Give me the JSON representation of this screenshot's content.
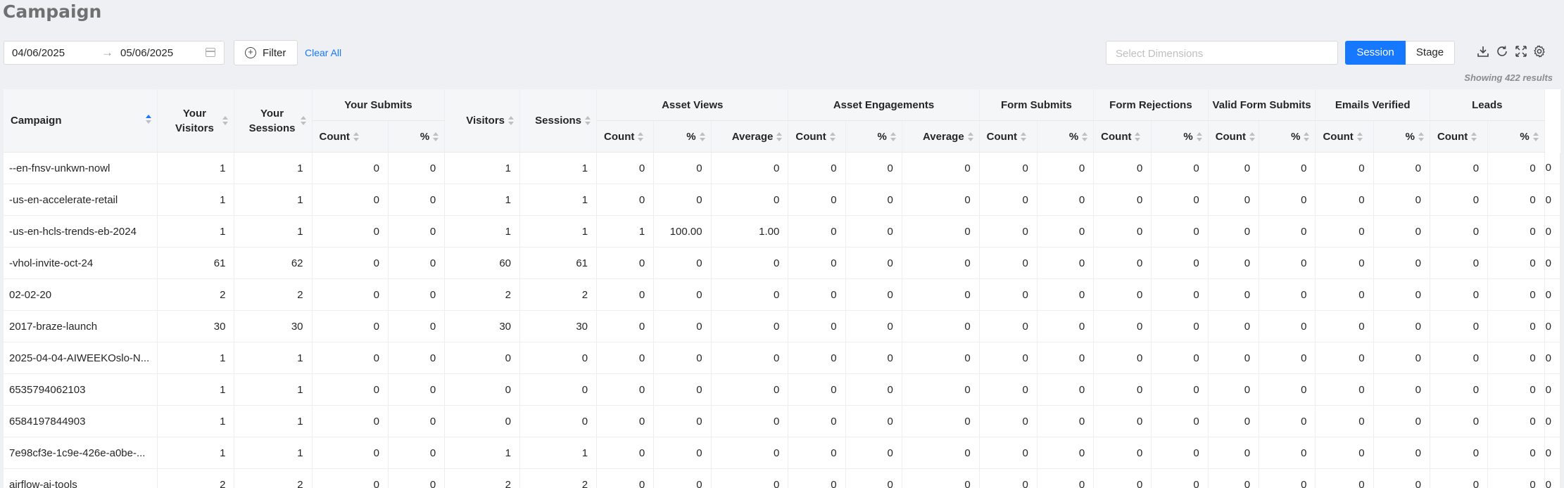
{
  "page": {
    "title": "Campaign"
  },
  "toolbar": {
    "date_start": "04/06/2025",
    "date_end": "05/06/2025",
    "filter_label": "Filter",
    "clear_all_label": "Clear All",
    "dimensions_placeholder": "Select Dimensions",
    "session_label": "Session",
    "stage_label": "Stage",
    "accent_color": "#1677ff",
    "icons": [
      "download-icon",
      "refresh-icon",
      "fullscreen-icon",
      "settings-icon"
    ]
  },
  "results_text": "Showing 422 results",
  "table": {
    "groups": {
      "campaign": "Campaign",
      "your_visitors": "Your Visitors",
      "your_sessions": "Your Sessions",
      "your_submits": "Your Submits",
      "visitors": "Visitors",
      "sessions": "Sessions",
      "asset_views": "Asset Views",
      "asset_engagements": "Asset Engagements",
      "form_submits": "Form Submits",
      "form_rejections": "Form Rejections",
      "valid_form_submits": "Valid Form Submits",
      "emails_verified": "Emails Verified",
      "leads": "Leads"
    },
    "sub": {
      "count": "Count",
      "pct": "%",
      "average": "Average"
    },
    "rows": [
      {
        "name": "--en-fnsv-unkwn-nowl",
        "cells": [
          "1",
          "1",
          "0",
          "0",
          "1",
          "1",
          "0",
          "0",
          "0",
          "0",
          "0",
          "0",
          "0",
          "0",
          "0",
          "0",
          "0",
          "0",
          "0",
          "0",
          "0",
          "0",
          "0"
        ]
      },
      {
        "name": "-us-en-accelerate-retail",
        "cells": [
          "1",
          "1",
          "0",
          "0",
          "1",
          "1",
          "0",
          "0",
          "0",
          "0",
          "0",
          "0",
          "0",
          "0",
          "0",
          "0",
          "0",
          "0",
          "0",
          "0",
          "0",
          "0",
          "0"
        ]
      },
      {
        "name": "-us-en-hcls-trends-eb-2024",
        "cells": [
          "1",
          "1",
          "0",
          "0",
          "1",
          "1",
          "1",
          "100.00",
          "1.00",
          "0",
          "0",
          "0",
          "0",
          "0",
          "0",
          "0",
          "0",
          "0",
          "0",
          "0",
          "0",
          "0",
          "0"
        ]
      },
      {
        "name": "-vhol-invite-oct-24",
        "cells": [
          "61",
          "62",
          "0",
          "0",
          "60",
          "61",
          "0",
          "0",
          "0",
          "0",
          "0",
          "0",
          "0",
          "0",
          "0",
          "0",
          "0",
          "0",
          "0",
          "0",
          "0",
          "0",
          "0"
        ]
      },
      {
        "name": "02-02-20",
        "cells": [
          "2",
          "2",
          "0",
          "0",
          "2",
          "2",
          "0",
          "0",
          "0",
          "0",
          "0",
          "0",
          "0",
          "0",
          "0",
          "0",
          "0",
          "0",
          "0",
          "0",
          "0",
          "0",
          "0"
        ]
      },
      {
        "name": "2017-braze-launch",
        "cells": [
          "30",
          "30",
          "0",
          "0",
          "30",
          "30",
          "0",
          "0",
          "0",
          "0",
          "0",
          "0",
          "0",
          "0",
          "0",
          "0",
          "0",
          "0",
          "0",
          "0",
          "0",
          "0",
          "0"
        ]
      },
      {
        "name": "2025-04-04-AIWEEKOslo-N...",
        "cells": [
          "1",
          "1",
          "0",
          "0",
          "0",
          "0",
          "0",
          "0",
          "0",
          "0",
          "0",
          "0",
          "0",
          "0",
          "0",
          "0",
          "0",
          "0",
          "0",
          "0",
          "0",
          "0",
          "0"
        ]
      },
      {
        "name": "6535794062103",
        "cells": [
          "1",
          "1",
          "0",
          "0",
          "0",
          "0",
          "0",
          "0",
          "0",
          "0",
          "0",
          "0",
          "0",
          "0",
          "0",
          "0",
          "0",
          "0",
          "0",
          "0",
          "0",
          "0",
          "0"
        ]
      },
      {
        "name": "6584197844903",
        "cells": [
          "1",
          "1",
          "0",
          "0",
          "0",
          "0",
          "0",
          "0",
          "0",
          "0",
          "0",
          "0",
          "0",
          "0",
          "0",
          "0",
          "0",
          "0",
          "0",
          "0",
          "0",
          "0",
          "0"
        ]
      },
      {
        "name": "7e98cf3e-1c9e-426e-a0be-...",
        "cells": [
          "1",
          "1",
          "0",
          "0",
          "1",
          "1",
          "0",
          "0",
          "0",
          "0",
          "0",
          "0",
          "0",
          "0",
          "0",
          "0",
          "0",
          "0",
          "0",
          "0",
          "0",
          "0",
          "0"
        ]
      },
      {
        "name": "airflow-ai-tools",
        "cells": [
          "2",
          "2",
          "0",
          "0",
          "2",
          "2",
          "0",
          "0",
          "0",
          "0",
          "0",
          "0",
          "0",
          "0",
          "0",
          "0",
          "0",
          "0",
          "0",
          "0",
          "0",
          "0",
          "0"
        ]
      }
    ]
  }
}
